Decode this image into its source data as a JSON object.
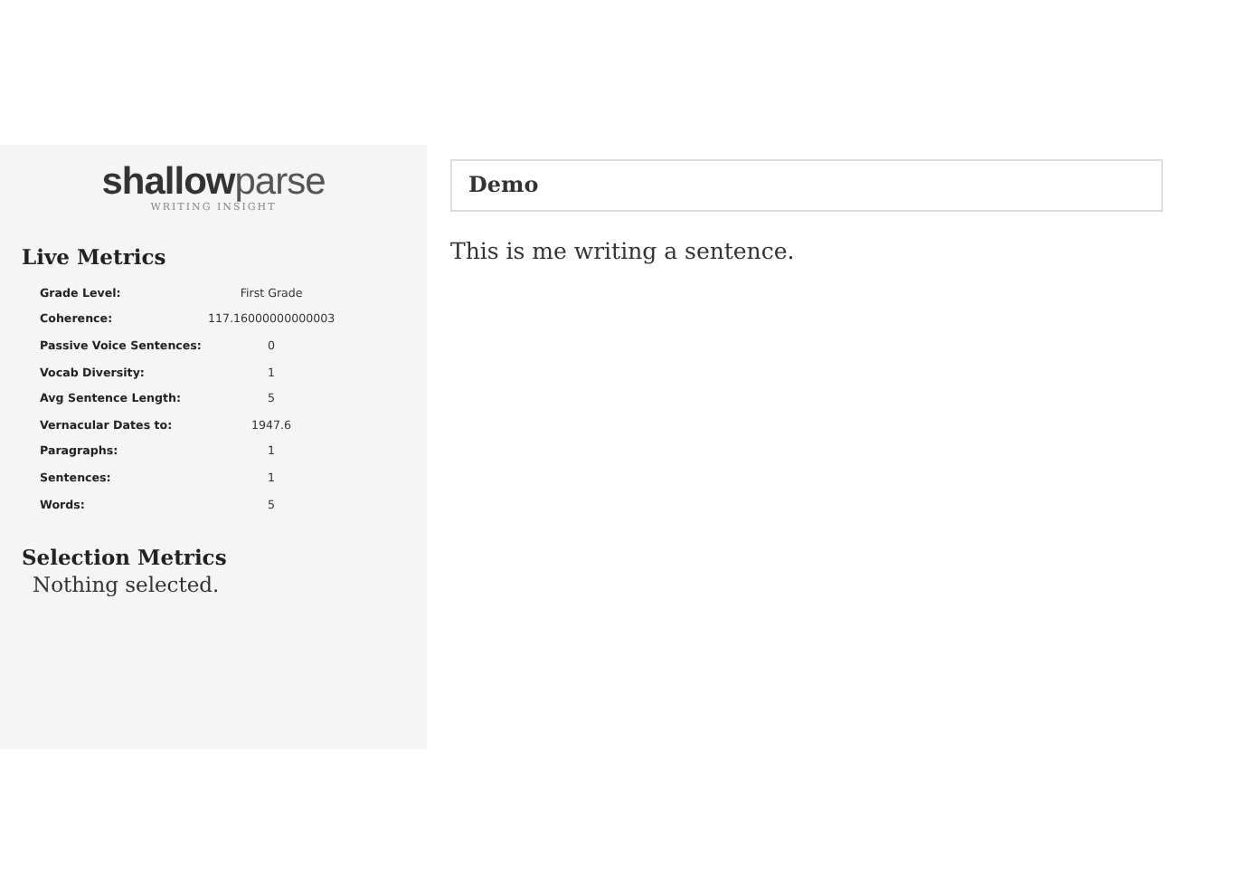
{
  "sidebar": {
    "logo": "**shallow**parse",
    "tagline": "WRITING INSIGHT",
    "live_metrics": {
      "title": "Live Metrics",
      "rows": [
        {
          "label": "Grade Level:",
          "value": "First Grade"
        },
        {
          "label": "Coherence:",
          "value": "117.16000000000003"
        },
        {
          "label": "Passive Voice Sentences:",
          "value": "0"
        },
        {
          "label": "Vocab Diversity:",
          "value": "1"
        },
        {
          "label": "Avg Sentence Length:",
          "value": "5"
        },
        {
          "label": "Vernacular Dates to:",
          "value": "1947.6"
        },
        {
          "label": "Paragraphs:",
          "value": "1"
        },
        {
          "label": "Sentences:",
          "value": "1"
        },
        {
          "label": "Words:",
          "value": "5"
        }
      ]
    },
    "selection_metrics": {
      "title": "Selection Metrics",
      "message": "Nothing selected."
    }
  },
  "editor": {
    "title": {
      "value": "Demo"
    },
    "body": "This is me writing a sentence."
  }
}
